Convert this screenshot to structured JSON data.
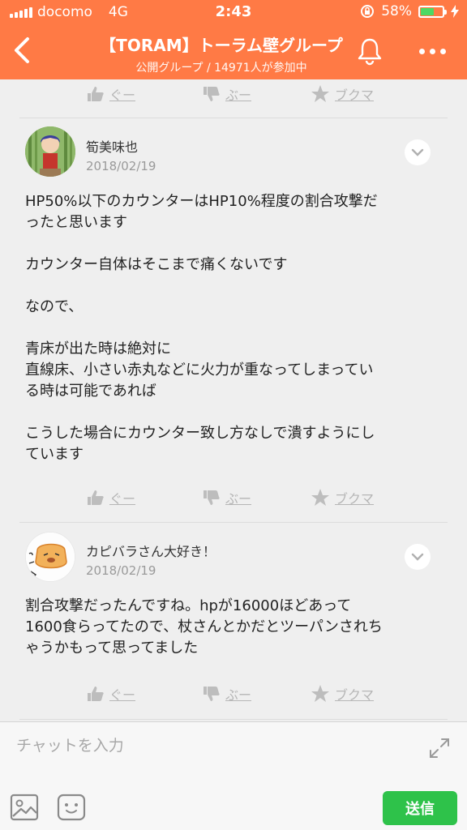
{
  "status": {
    "carrier": "docomo",
    "network": "4G",
    "time": "2:43",
    "battery": "58%"
  },
  "header": {
    "title": "【TORAM】トーラム壁グループ",
    "subtitle": "公開グループ / 14971人が参加中"
  },
  "reactions": {
    "like": "ぐー",
    "dislike": "ぶー",
    "bookmark": "ブクマ"
  },
  "posts": [
    {
      "author": "筍美味也",
      "date": "2018/02/19",
      "lines": [
        "HP50%以下のカウンターはHP10%程度の割合攻撃だ",
        "ったと思います",
        "",
        "カウンター自体はそこまで痛くないです",
        "",
        "なので、",
        "",
        "青床が出た時は絶対に",
        "直線床、小さい赤丸などに火力が重なってしまってい",
        "る時は可能であれば",
        "",
        "こうした場合にカウンター致し方なしで潰すようにし",
        "ています"
      ]
    },
    {
      "author": "カピバラさん大好き！",
      "date": "2018/02/19",
      "lines": [
        "割合攻撃だったんですね。hpが16000ほどあって",
        "1600食らってたので、杖さんとかだとツーパンされち",
        "ゃうかもって思ってました"
      ]
    }
  ],
  "composer": {
    "placeholder": "チャットを入力",
    "send_label": "送信"
  },
  "colors": {
    "accent": "#ff7a45",
    "send": "#2ec24a",
    "battery": "#4cd964"
  }
}
